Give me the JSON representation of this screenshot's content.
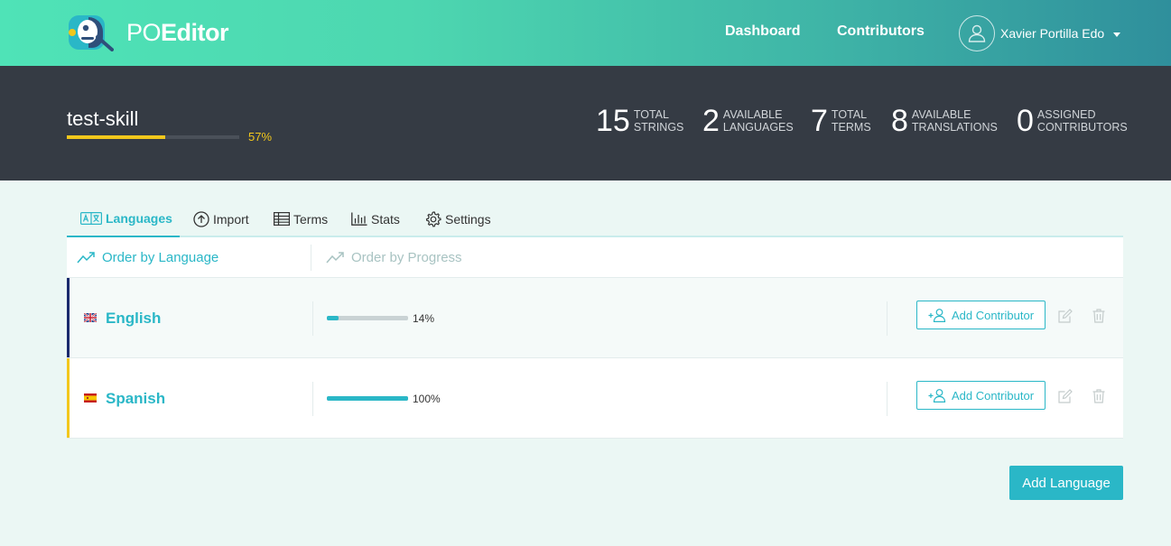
{
  "brand": {
    "logo_text_light": "PO",
    "logo_text_bold": "Editor"
  },
  "nav": {
    "dashboard": "Dashboard",
    "contributors": "Contributors",
    "user_name": "Xavier Portilla Edo"
  },
  "project": {
    "name": "test-skill",
    "progress": 0.57,
    "progress_label": "57%",
    "stats": [
      {
        "value": "15",
        "label": "Total\nStrings"
      },
      {
        "value": "2",
        "label": "Available\nLanguages"
      },
      {
        "value": "7",
        "label": "Total\nTerms"
      },
      {
        "value": "8",
        "label": "Available\nTranslations"
      },
      {
        "value": "0",
        "label": "Assigned\nContributors"
      }
    ]
  },
  "tabs": [
    {
      "label": "Languages",
      "icon": "languages-icon",
      "active": true
    },
    {
      "label": "Import",
      "icon": "upload-circle-icon"
    },
    {
      "label": "Terms",
      "icon": "table-icon"
    },
    {
      "label": "Stats",
      "icon": "bar-chart-icon"
    },
    {
      "label": "Settings",
      "icon": "gear-icon"
    }
  ],
  "list": {
    "order_by_language": "Order by Language",
    "order_by_progress": "Order by Progress",
    "add_contributor_label": "Add Contributor",
    "languages": [
      {
        "name": "English",
        "flag": "uk-flag-icon",
        "progress": 0.14,
        "progress_label": "14%",
        "accent": "#1a2a6c"
      },
      {
        "name": "Spanish",
        "flag": "spain-flag-icon",
        "progress": 1.0,
        "progress_label": "100%",
        "accent": "#f2c71c"
      }
    ]
  },
  "add_language_label": "Add Language",
  "colors": {
    "accent": "#2ab7c7",
    "header_dark": "#353b44",
    "progress_yellow": "#f2c71c"
  }
}
